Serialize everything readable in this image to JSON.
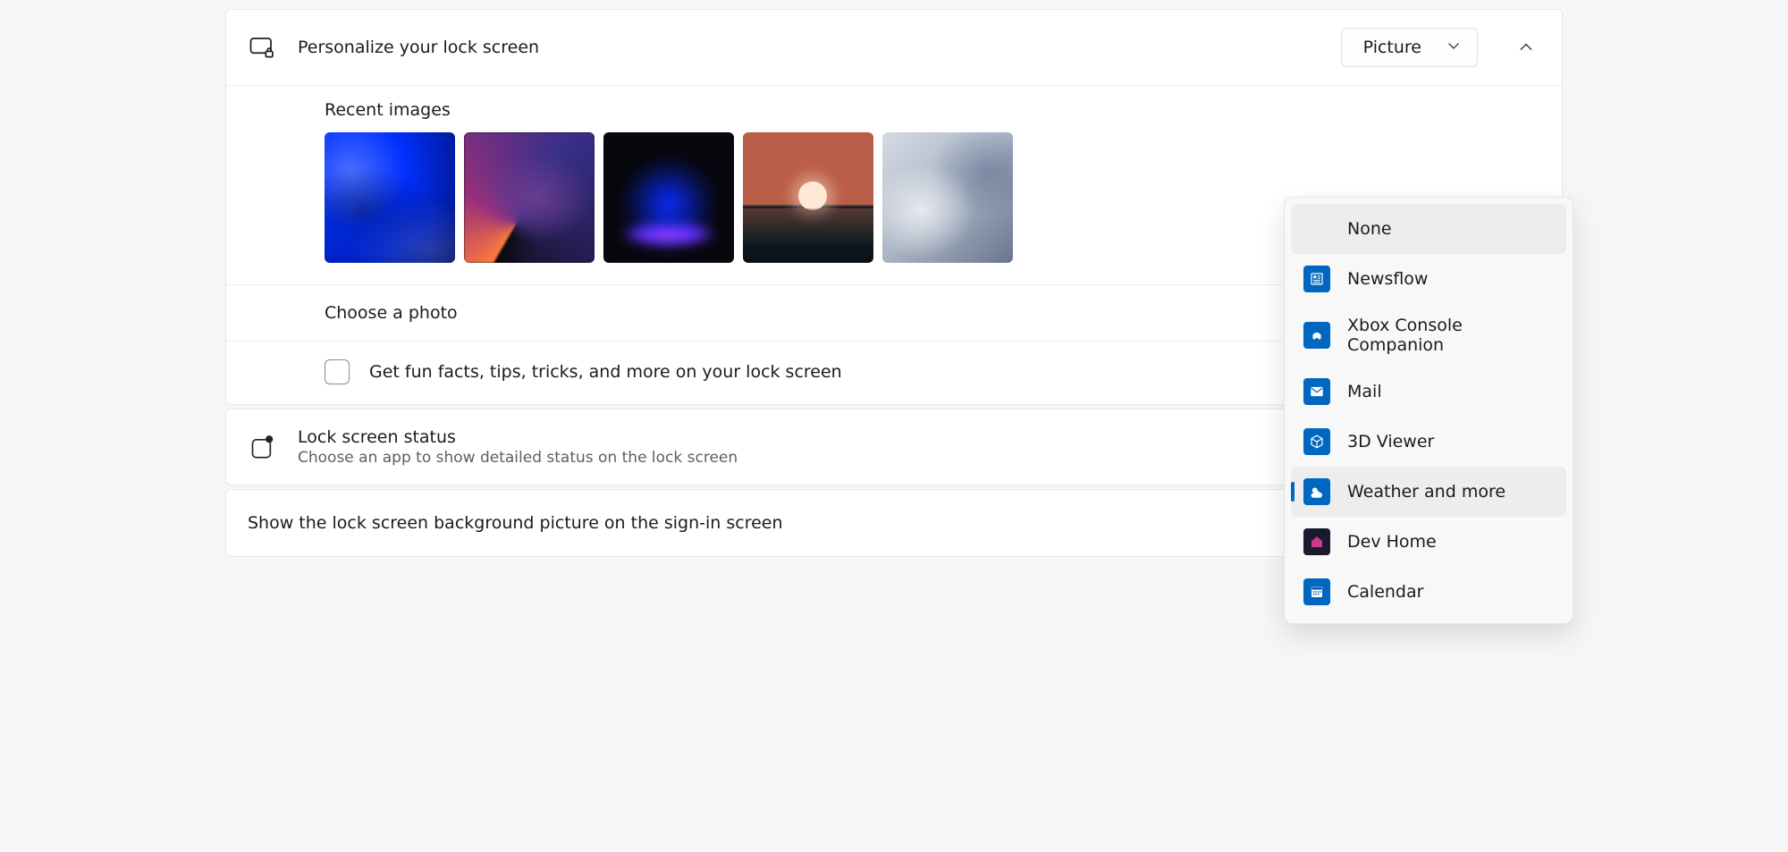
{
  "personalize": {
    "title": "Personalize your lock screen",
    "dropdown_value": "Picture"
  },
  "recent": {
    "label": "Recent images"
  },
  "choose": {
    "label": "Choose a photo"
  },
  "funfacts": {
    "label": "Get fun facts, tips, tricks, and more on your lock screen"
  },
  "status": {
    "title": "Lock screen status",
    "subtitle": "Choose an app to show detailed status on the lock screen"
  },
  "signin": {
    "label": "Show the lock screen background picture on the sign-in screen"
  },
  "menu": {
    "none": "None",
    "items": [
      {
        "label": "Newsflow",
        "icon": "news"
      },
      {
        "label": "Xbox Console Companion",
        "icon": "xbox"
      },
      {
        "label": "Mail",
        "icon": "mail"
      },
      {
        "label": "3D Viewer",
        "icon": "cube"
      },
      {
        "label": "Weather and more",
        "icon": "weather"
      },
      {
        "label": "Dev Home",
        "icon": "devhome"
      },
      {
        "label": "Calendar",
        "icon": "calendar"
      }
    ],
    "selected": "Weather and more"
  }
}
